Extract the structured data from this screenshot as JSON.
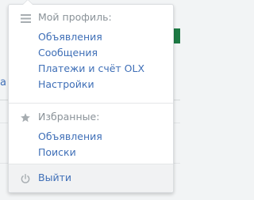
{
  "background": {
    "left_text_fragment": "а"
  },
  "menu": {
    "profile": {
      "title": "Мой профиль:",
      "icon": "menu-lines-icon",
      "items": [
        "Объявления",
        "Сообщения",
        "Платежи и счёт OLX",
        "Настройки"
      ]
    },
    "favorites": {
      "title": "Избранные:",
      "icon": "star-icon",
      "items": [
        "Объявления",
        "Поиски"
      ]
    },
    "logout": {
      "label": "Выйти",
      "icon": "power-icon"
    }
  },
  "colors": {
    "link": "#3f6fb7",
    "muted": "#8a9298",
    "footer_bg": "#f1f2f3",
    "accent_green": "#1d7a44"
  }
}
